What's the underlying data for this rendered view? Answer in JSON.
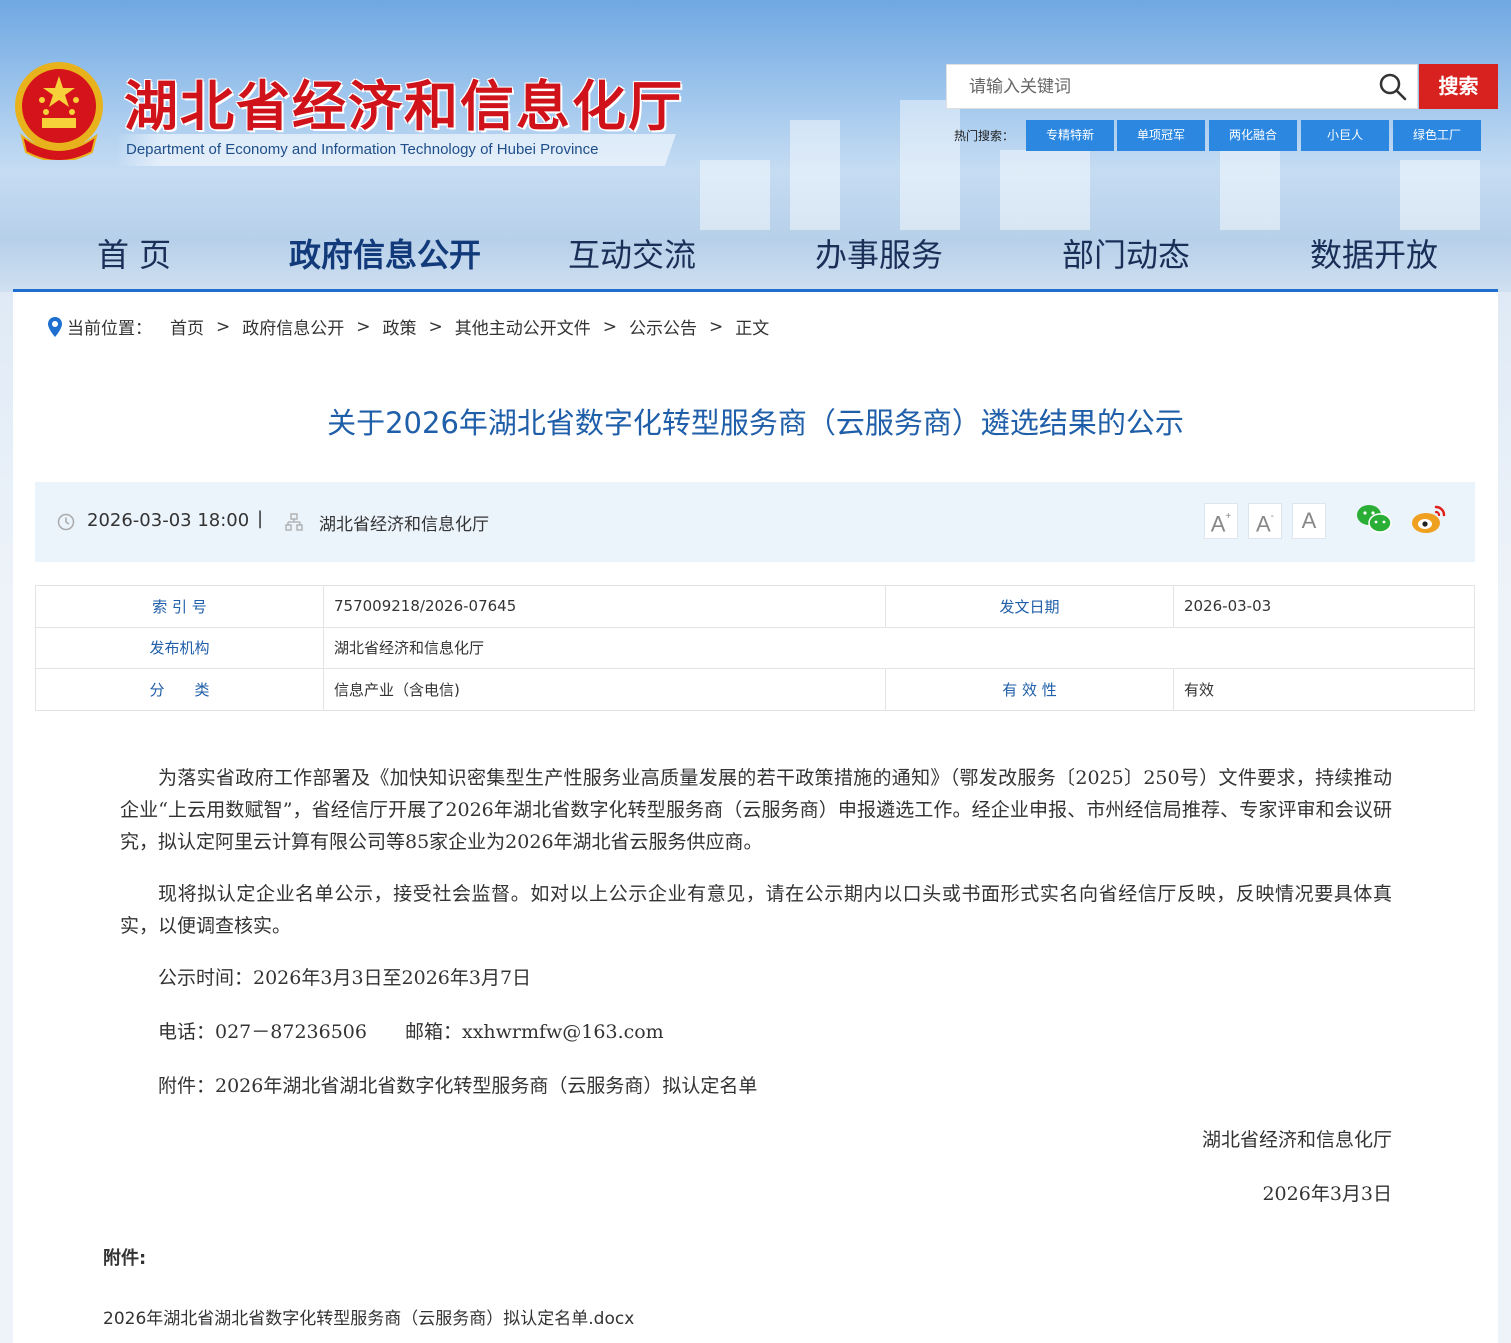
{
  "header": {
    "title": "湖北省经济和信息化厅",
    "subtitle": "Department of Economy and Information Technology of Hubei Province",
    "search": {
      "placeholder": "请输入关键词",
      "button_label": "搜索"
    },
    "hot_search": {
      "label": "热门搜索：",
      "tags": [
        "专精特新",
        "单项冠军",
        "两化融合",
        "小巨人",
        "绿色工厂"
      ]
    },
    "nav": [
      "首  页",
      "政府信息公开",
      "互动交流",
      "办事服务",
      "部门动态",
      "数据开放"
    ],
    "nav_active": "政府信息公开"
  },
  "breadcrumb": {
    "label": "当前位置：",
    "items": [
      "首页",
      "政府信息公开",
      "政策",
      "其他主动公开文件",
      "公示公告",
      "正文"
    ],
    "separator": ">"
  },
  "article": {
    "title": "关于2026年湖北省数字化转型服务商（云服务商）遴选结果的公示",
    "meta": {
      "datetime": "2026-03-03 18:00",
      "separator": "|",
      "source": "湖北省经济和信息化厅",
      "font_buttons": [
        "A+",
        "A-",
        "A"
      ]
    },
    "info": {
      "index_label": "索 引 号",
      "index_value": "757009218/2026-07645",
      "date_label": "发文日期",
      "date_value": "2026-03-03",
      "org_label": "发布机构",
      "org_value": "湖北省经济和信息化厅",
      "category_label": "分　　类",
      "category_value": "信息产业（含电信)",
      "validity_label": "有 效 性",
      "validity_value": "有效"
    },
    "paragraphs": [
      "为落实省政府工作部署及《加快知识密集型生产性服务业高质量发展的若干政策措施的通知》（鄂发改服务〔2025〕250号）文件要求，持续推动企业“上云用数赋智”，省经信厅开展了2026年湖北省数字化转型服务商（云服务商）申报遴选工作。经企业申报、市州经信局推荐、专家评审和会议研究，拟认定阿里云计算有限公司等85家企业为2026年湖北省云服务供应商。",
      "现将拟认定企业名单公示，接受社会监督。如对以上公示企业有意见，请在公示期内以口头或书面形式实名向省经信厅反映，反映情况要具体真实，以便调查核实。"
    ],
    "notice_time": "公示时间：2026年3月3日至2026年3月7日",
    "contact": "电话：027－87236506　　邮箱：xxhwrmfw@163.com",
    "attachment_line": "附件：2026年湖北省湖北省数字化转型服务商（云服务商）拟认定名单",
    "signature": "湖北省经济和信息化厅",
    "sign_date": "2026年3月3日",
    "attachments_heading": "附件:",
    "attachment_file": "2026年湖北省湖北省数字化转型服务商（云服务商）拟认定名单.docx"
  },
  "colors": {
    "brand_red": "#d0131a",
    "title_blue": "#1f5ea8",
    "hot_tag_blue": "#2b87e0",
    "search_red": "#d7221f",
    "nav_line": "#1e6fd0",
    "wechat_green": "#2aae35",
    "weibo_orange": "#f0a020"
  },
  "icons": {
    "emblem": "national-emblem-icon",
    "search": "search-icon",
    "location": "location-pin-icon",
    "clock": "clock-icon",
    "org": "organization-icon",
    "wechat": "wechat-icon",
    "weibo": "weibo-icon"
  }
}
